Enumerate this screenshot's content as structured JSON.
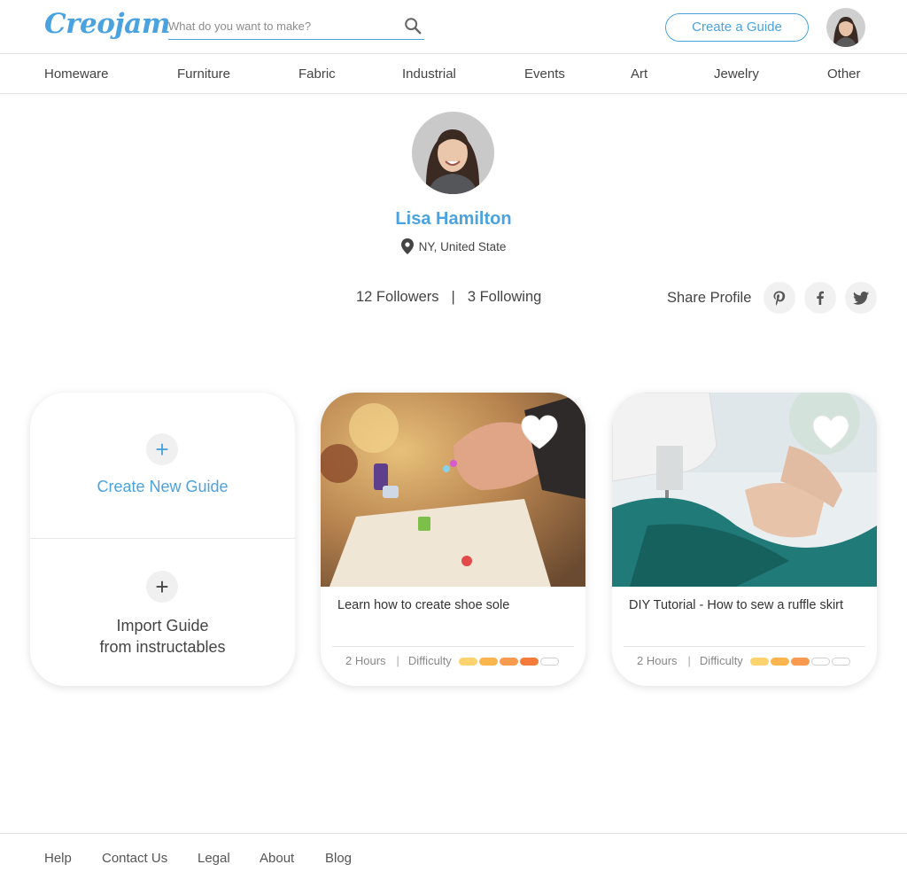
{
  "brand": {
    "logo_text": "Creojam",
    "accent": "#4aa3df"
  },
  "header": {
    "search_placeholder": "What do you want to make?",
    "search_icon": "search-icon",
    "create_guide_label": "Create a Guide",
    "avatar": "user-avatar"
  },
  "nav": {
    "items": [
      {
        "label": "Homeware"
      },
      {
        "label": "Furniture"
      },
      {
        "label": "Fabric"
      },
      {
        "label": "Industrial"
      },
      {
        "label": "Events"
      },
      {
        "label": "Art"
      },
      {
        "label": "Jewelry"
      },
      {
        "label": "Other"
      }
    ]
  },
  "profile": {
    "name": "Lisa Hamilton",
    "location": "NY, United State",
    "followers": "12 Followers",
    "separator": "|",
    "following": "3 Following",
    "share_label": "Share Profile",
    "social": [
      "pinterest-icon",
      "facebook-icon",
      "twitter-icon"
    ]
  },
  "actions": {
    "create_new": "Create New Guide",
    "import_line1": "Import Guide",
    "import_line2": "from instructables"
  },
  "guides": [
    {
      "title": "Learn how to create shoe sole",
      "hours": "2 Hours",
      "separator": "|",
      "difficulty_label": "Difficulty",
      "difficulty": 4,
      "difficulty_max": 5
    },
    {
      "title": "DIY Tutorial - How to sew a ruffle skirt",
      "hours": "2 Hours",
      "separator": "|",
      "difficulty_label": "Difficulty",
      "difficulty": 3,
      "difficulty_max": 5
    }
  ],
  "difficulty_colors": [
    "#fcd36f",
    "#fbb54f",
    "#f99a4e",
    "#f47b3a",
    "#f47b3a"
  ],
  "footer": {
    "links": [
      {
        "label": "Help"
      },
      {
        "label": "Contact Us"
      },
      {
        "label": "Legal"
      },
      {
        "label": "About"
      },
      {
        "label": "Blog"
      }
    ]
  }
}
